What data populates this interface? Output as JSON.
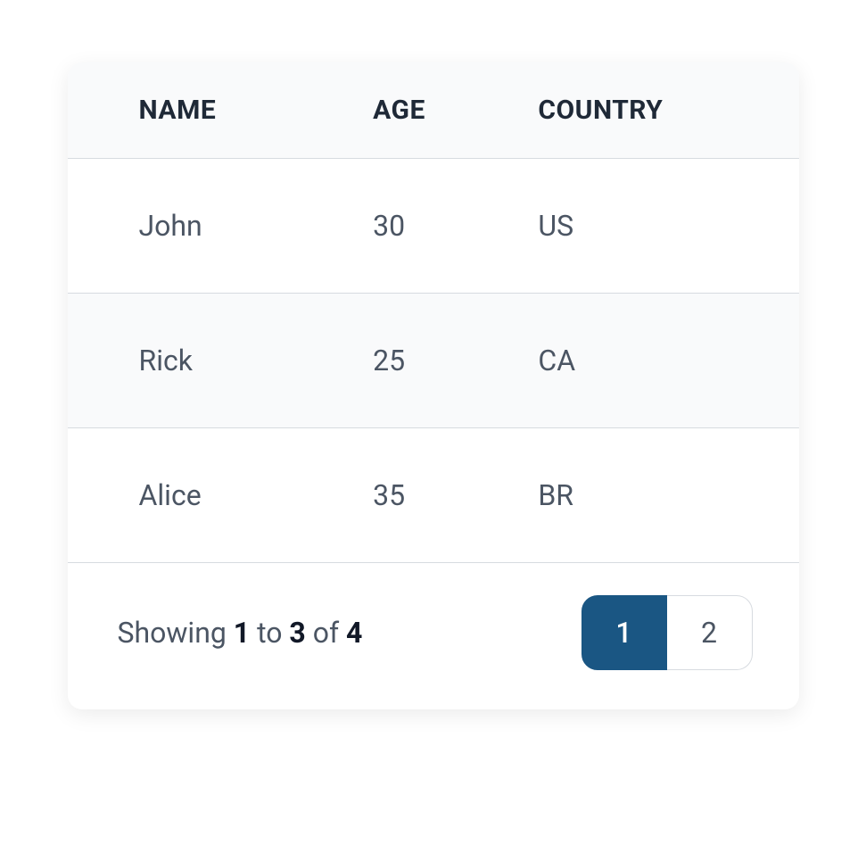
{
  "table": {
    "columns": [
      {
        "label": "NAME"
      },
      {
        "label": "AGE"
      },
      {
        "label": "COUNTRY"
      }
    ],
    "rows": [
      {
        "name": "John",
        "age": "30",
        "country": "US"
      },
      {
        "name": "Rick",
        "age": "25",
        "country": "CA"
      },
      {
        "name": "Alice",
        "age": "35",
        "country": "BR"
      }
    ]
  },
  "footer": {
    "showing_prefix": "Showing ",
    "from": "1",
    "to_word": " to ",
    "to": "3",
    "of_word": " of ",
    "total": "4"
  },
  "pagination": {
    "pages": [
      {
        "label": "1",
        "active": true
      },
      {
        "label": "2",
        "active": false
      }
    ]
  }
}
